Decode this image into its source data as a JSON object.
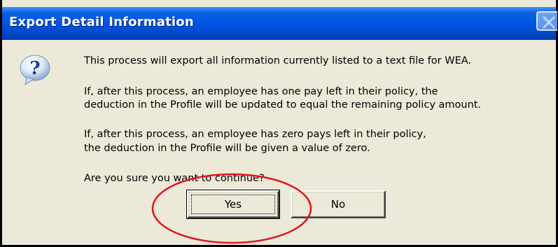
{
  "window": {
    "title": "Export Detail Information"
  },
  "dialog": {
    "icon": "question-icon",
    "messages": [
      "This process will export all information currently listed to a text file for WEA.",
      "If, after this process, an employee has one pay left in their policy, the",
      "deduction in the Profile will be updated to equal the remaining policy amount.",
      "If, after this process, an employee has zero pays left in their policy,",
      "the deduction in the Profile will be given a value of zero.",
      "Are you sure you want to continue?"
    ]
  },
  "buttons": {
    "yes_label": "Yes",
    "no_label": "No"
  },
  "colors": {
    "titlebar": "#0055e5",
    "dialog_bg": "#ece9d8",
    "annotation_circle": "#e0141e"
  }
}
